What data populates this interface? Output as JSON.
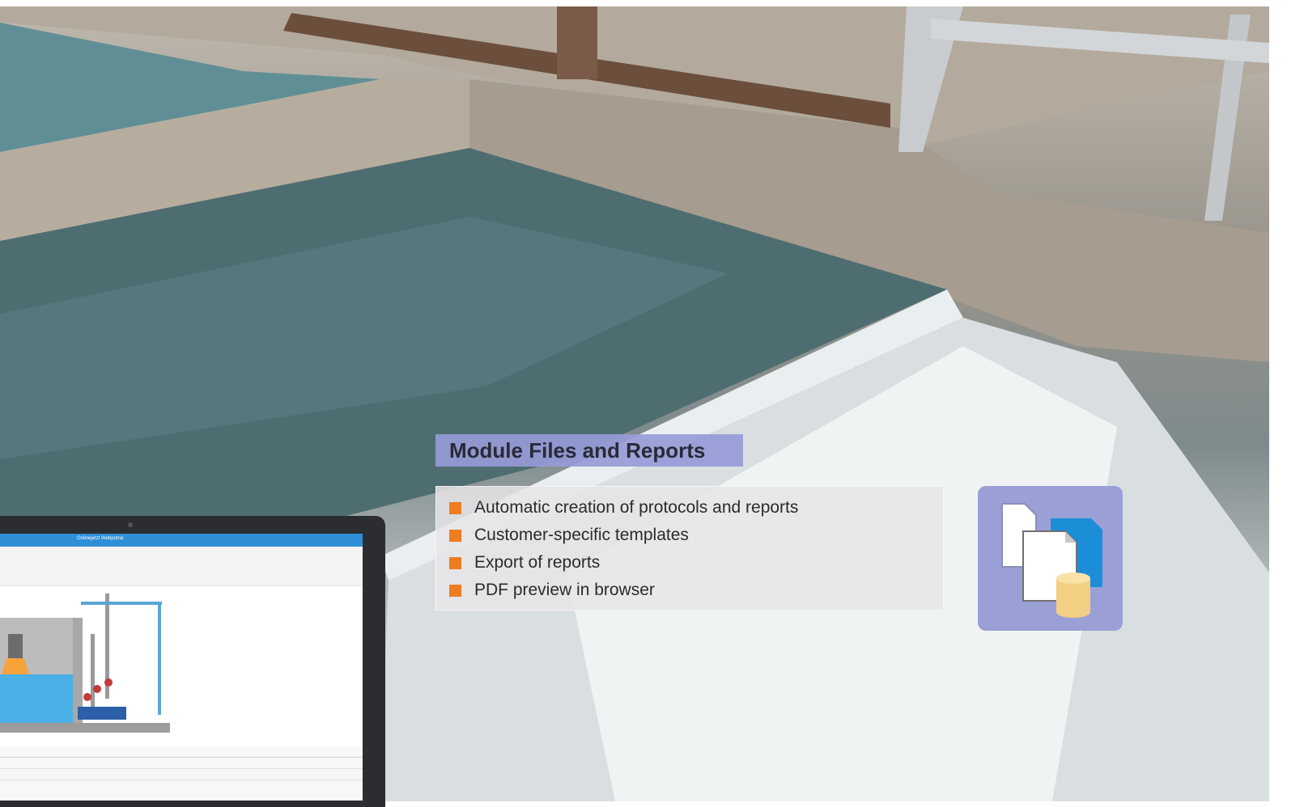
{
  "title": "Module Files and Reports",
  "features": [
    "Automatic creation of protocols and reports",
    "Customer-specific templates",
    "Export of reports",
    "PDF preview in browser"
  ],
  "colors": {
    "bullet": "#ee7d22",
    "title_bg": "#969bd7",
    "icon_bg": "#9aa0d6"
  },
  "icons": [
    "files-database-icon"
  ],
  "laptop": {
    "app_title": "Onlinejetzt Webportal"
  }
}
